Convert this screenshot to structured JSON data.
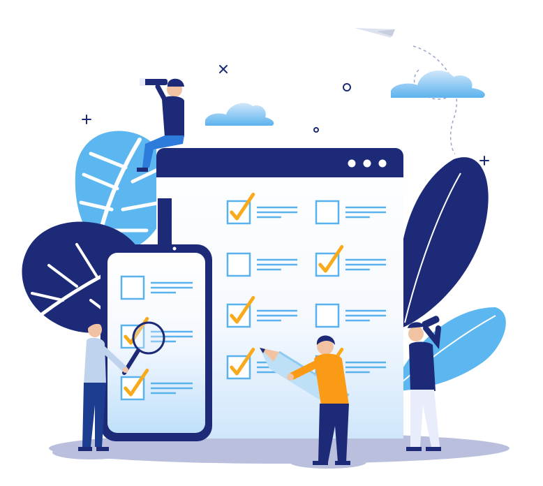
{
  "illustration": {
    "colors": {
      "navy": "#1c2a78",
      "light_blue": "#5cb6ef",
      "pale_blue": "#dcecfb",
      "checkbox_blue": "#5ab2ec",
      "check_orange": "#f8a91c",
      "shirt_orange": "#fb9a14",
      "skin": "#f2c3a3",
      "ground": "#b9bfdc"
    },
    "browser_window": {
      "header_dots": 3,
      "checklist": [
        {
          "checked": true
        },
        {
          "checked": false
        },
        {
          "checked": false
        },
        {
          "checked": true
        },
        {
          "checked": true
        },
        {
          "checked": false
        },
        {
          "checked": true
        },
        {
          "checked": true
        }
      ]
    },
    "phone": {
      "checklist": [
        {
          "checked": false
        },
        {
          "checked": true
        },
        {
          "checked": true
        }
      ]
    },
    "icons": [
      "paper-plane-icon",
      "cloud-icon",
      "magnifier-icon",
      "pencil-icon",
      "telescope-icon",
      "binoculars-icon",
      "sparkle-icon"
    ]
  }
}
